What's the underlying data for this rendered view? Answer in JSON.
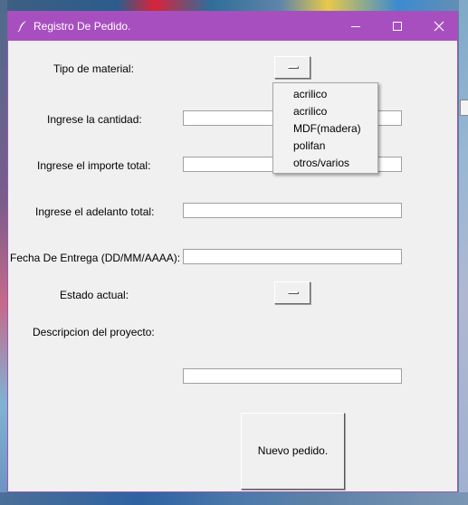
{
  "window": {
    "title": "Registro De Pedido.",
    "accent_color": "#a84fc0"
  },
  "form": {
    "tipo_material_label": "Tipo de material:",
    "cantidad_label": "Ingrese la cantidad:",
    "importe_label": "Ingrese el importe total:",
    "adelanto_label": "Ingrese el adelanto total:",
    "fecha_label": "Fecha De Entrega (DD/MM/AAAA):",
    "estado_label": "Estado actual:",
    "descripcion_label": "Descripcion del proyecto:",
    "cantidad_value": "",
    "importe_value": "",
    "adelanto_value": "",
    "fecha_value": "",
    "descripcion_value": ""
  },
  "material_menu": {
    "items": [
      "acrilico",
      "acrilico",
      "MDF(madera)",
      "polifan",
      "otros/varios"
    ]
  },
  "actions": {
    "nuevo_pedido_label": "Nuevo pedido."
  }
}
